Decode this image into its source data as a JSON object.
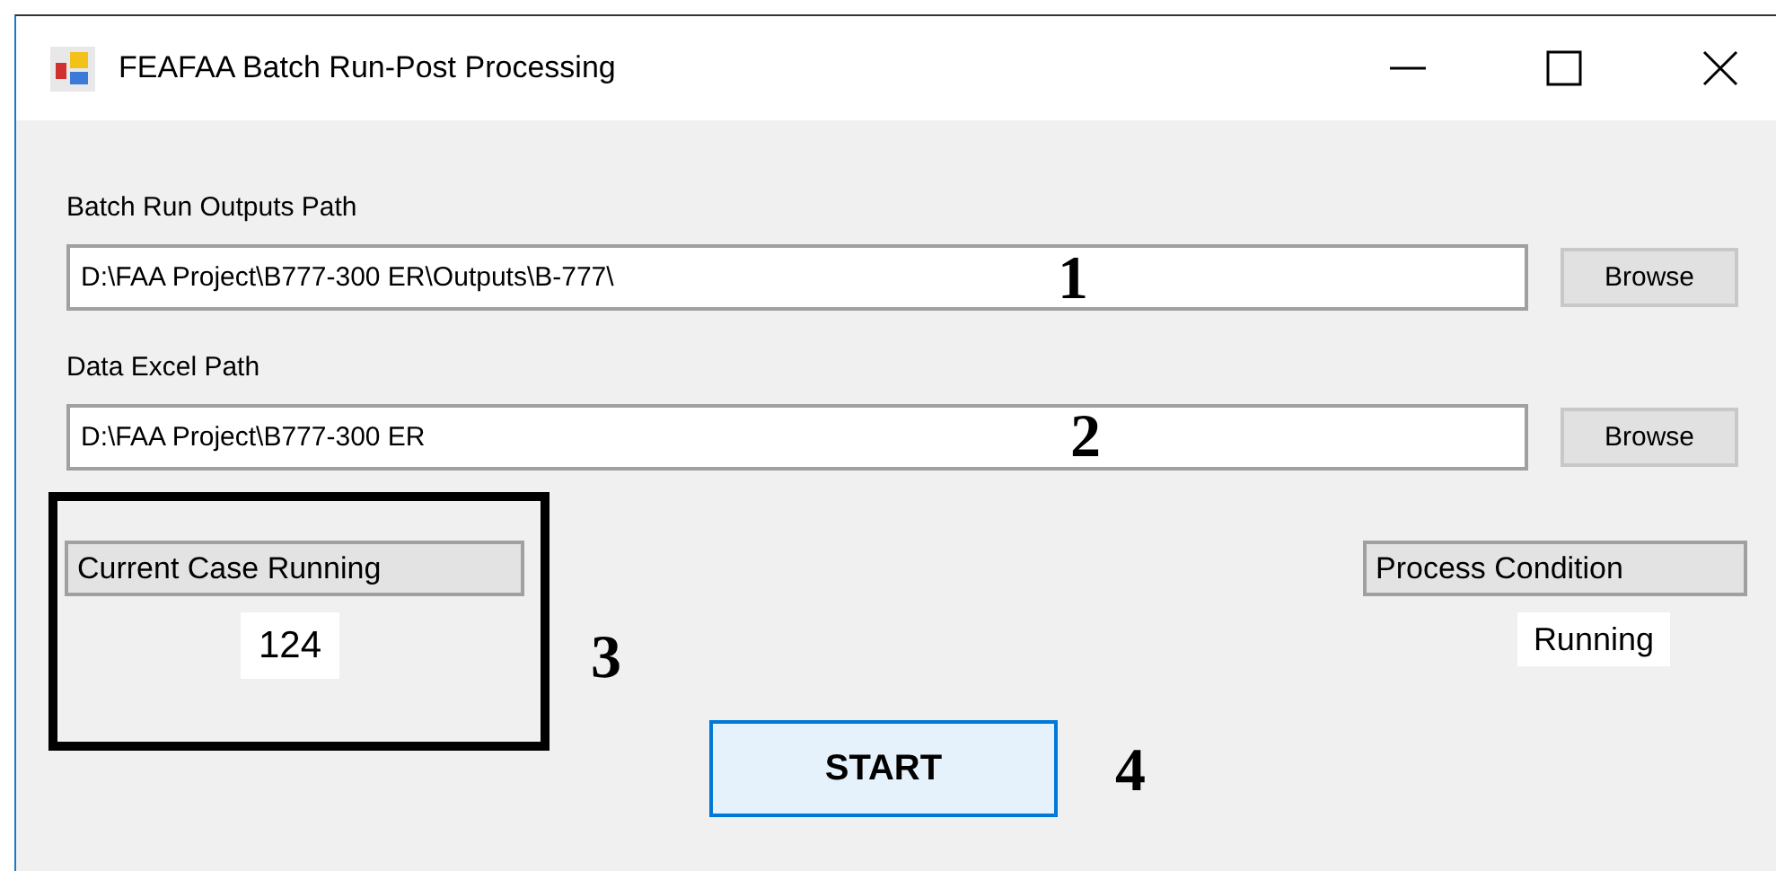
{
  "window": {
    "title": "FEAFAA Batch Run-Post Processing"
  },
  "path_fields": [
    {
      "label": "Batch Run Outputs Path",
      "value": "D:\\FAA Project\\B777-300 ER\\Outputs\\B-777\\",
      "button": "Browse"
    },
    {
      "label": "Data Excel Path",
      "value": "D:\\FAA Project\\B777-300 ER",
      "button": "Browse"
    }
  ],
  "current_case": {
    "label": "Current Case Running",
    "value": "124",
    "highlighted": true
  },
  "process_condition": {
    "label": "Process Condition",
    "value": "Running"
  },
  "start_button": "START",
  "annotations": [
    {
      "text": "1"
    },
    {
      "text": "2"
    },
    {
      "text": "3"
    },
    {
      "text": "4"
    }
  ]
}
